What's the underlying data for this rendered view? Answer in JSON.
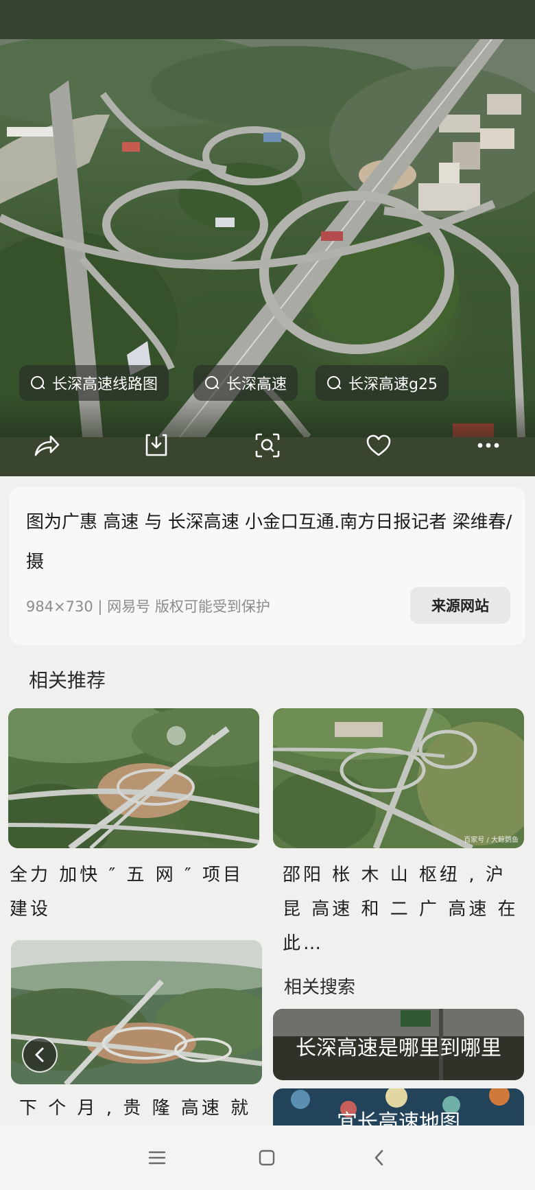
{
  "search_chips": [
    {
      "label": "长深高速线路图"
    },
    {
      "label": "长深高速"
    },
    {
      "label": "长深高速g25"
    }
  ],
  "actions": {
    "share_icon": "share-icon",
    "download_icon": "download-icon",
    "lens_icon": "visual-search-icon",
    "like_icon": "heart-icon",
    "more_icon": "more-icon"
  },
  "image_info": {
    "caption": "图为广惠 高速 与 长深高速 小金口互通.南方日报记者 梁维春/摄",
    "meta": "984×730 | 网易号 版权可能受到保护",
    "source_button": "来源网站"
  },
  "recommendations": {
    "title": "相关推荐",
    "items": [
      {
        "title": "全力 加快 ″ 五 网 ″ 项目 建设"
      },
      {
        "title": "邵阳 枨 木 山 枢纽 , 沪 昆 高速 和 二 广 高速 在 此…",
        "watermark": "百家号 / 大鲸鹦鱼"
      },
      {
        "title": "下 个 月 , 贵 隆 高速 就要"
      }
    ]
  },
  "related_search": {
    "title": "相关搜索",
    "items": [
      {
        "label": "长深高速是哪里到哪里"
      },
      {
        "label": "宜长高速地图"
      }
    ]
  },
  "colors": {
    "hero_bar": "#39452f",
    "card_bg": "#f8f8f6",
    "page_bg": "#f0f0ef"
  }
}
